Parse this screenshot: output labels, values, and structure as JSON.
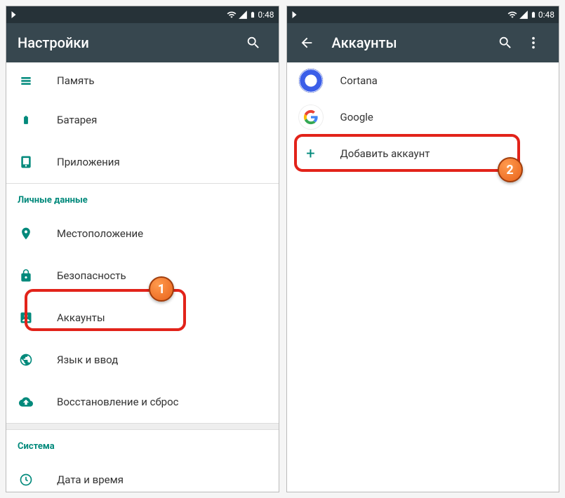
{
  "status": {
    "time": "0:48"
  },
  "screen1": {
    "title": "Настройки",
    "items_top": [
      {
        "icon": "memory",
        "label": "Память"
      },
      {
        "icon": "battery",
        "label": "Батарея"
      },
      {
        "icon": "apps",
        "label": "Приложения"
      }
    ],
    "section_personal": "Личные данные",
    "items_personal": [
      {
        "icon": "location",
        "label": "Местоположение"
      },
      {
        "icon": "security",
        "label": "Безопасность"
      },
      {
        "icon": "accounts",
        "label": "Аккаунты"
      },
      {
        "icon": "language",
        "label": "Язык и ввод"
      },
      {
        "icon": "backup",
        "label": "Восстановление и сброс"
      }
    ],
    "section_system": "Система",
    "items_system": [
      {
        "icon": "clock",
        "label": "Дата и время"
      }
    ]
  },
  "screen2": {
    "title": "Аккаунты",
    "accounts": [
      {
        "name": "Cortana",
        "type": "cortana"
      },
      {
        "name": "Google",
        "type": "google"
      }
    ],
    "add_label": "Добавить аккаунт"
  },
  "markers": {
    "m1": "1",
    "m2": "2"
  }
}
